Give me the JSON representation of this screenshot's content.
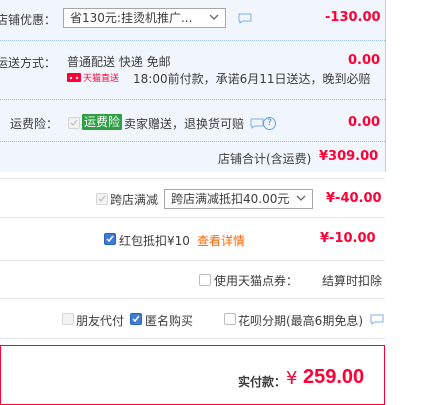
{
  "shop": {
    "discount": {
      "label": "店铺优惠：",
      "selected": "省130元:挂烫机推广...",
      "amount": "-130.00"
    },
    "shipping": {
      "label": "运送方式：",
      "method": "普通配送 快递 免邮",
      "badge": "天猫直送",
      "note": "18:00前付款，承诺6月11日送达，晚到必赔",
      "amount": "0.00"
    },
    "insurance": {
      "label": "运费险：",
      "tag": "运费险",
      "text": "卖家赠送，退换货可赔",
      "amount": "0.00"
    },
    "subtotal": {
      "label": "店铺合计(含运费)",
      "amount": "¥309.00"
    }
  },
  "cross_store": {
    "label": "跨店满减",
    "selected": "跨店满减抵扣40.00元",
    "amount": "¥-40.00"
  },
  "red_packet": {
    "label": "红包抵扣¥10",
    "link": "查看详情",
    "amount": "¥-10.00"
  },
  "tmall_points": {
    "label": "使用天猫点券：",
    "note": "结算时扣除"
  },
  "options": {
    "friend_pay": "朋友代付",
    "anonymous": "匿名购买",
    "huabei": "花呗分期(最高6期免息)"
  },
  "total": {
    "label": "实付款：",
    "currency": "¥",
    "amount": "259.00"
  },
  "colors": {
    "price_red": "#ff0036",
    "link_orange": "#ff6600",
    "shop_bg": "#f1f6fd",
    "check_blue": "#3d7bd6"
  }
}
